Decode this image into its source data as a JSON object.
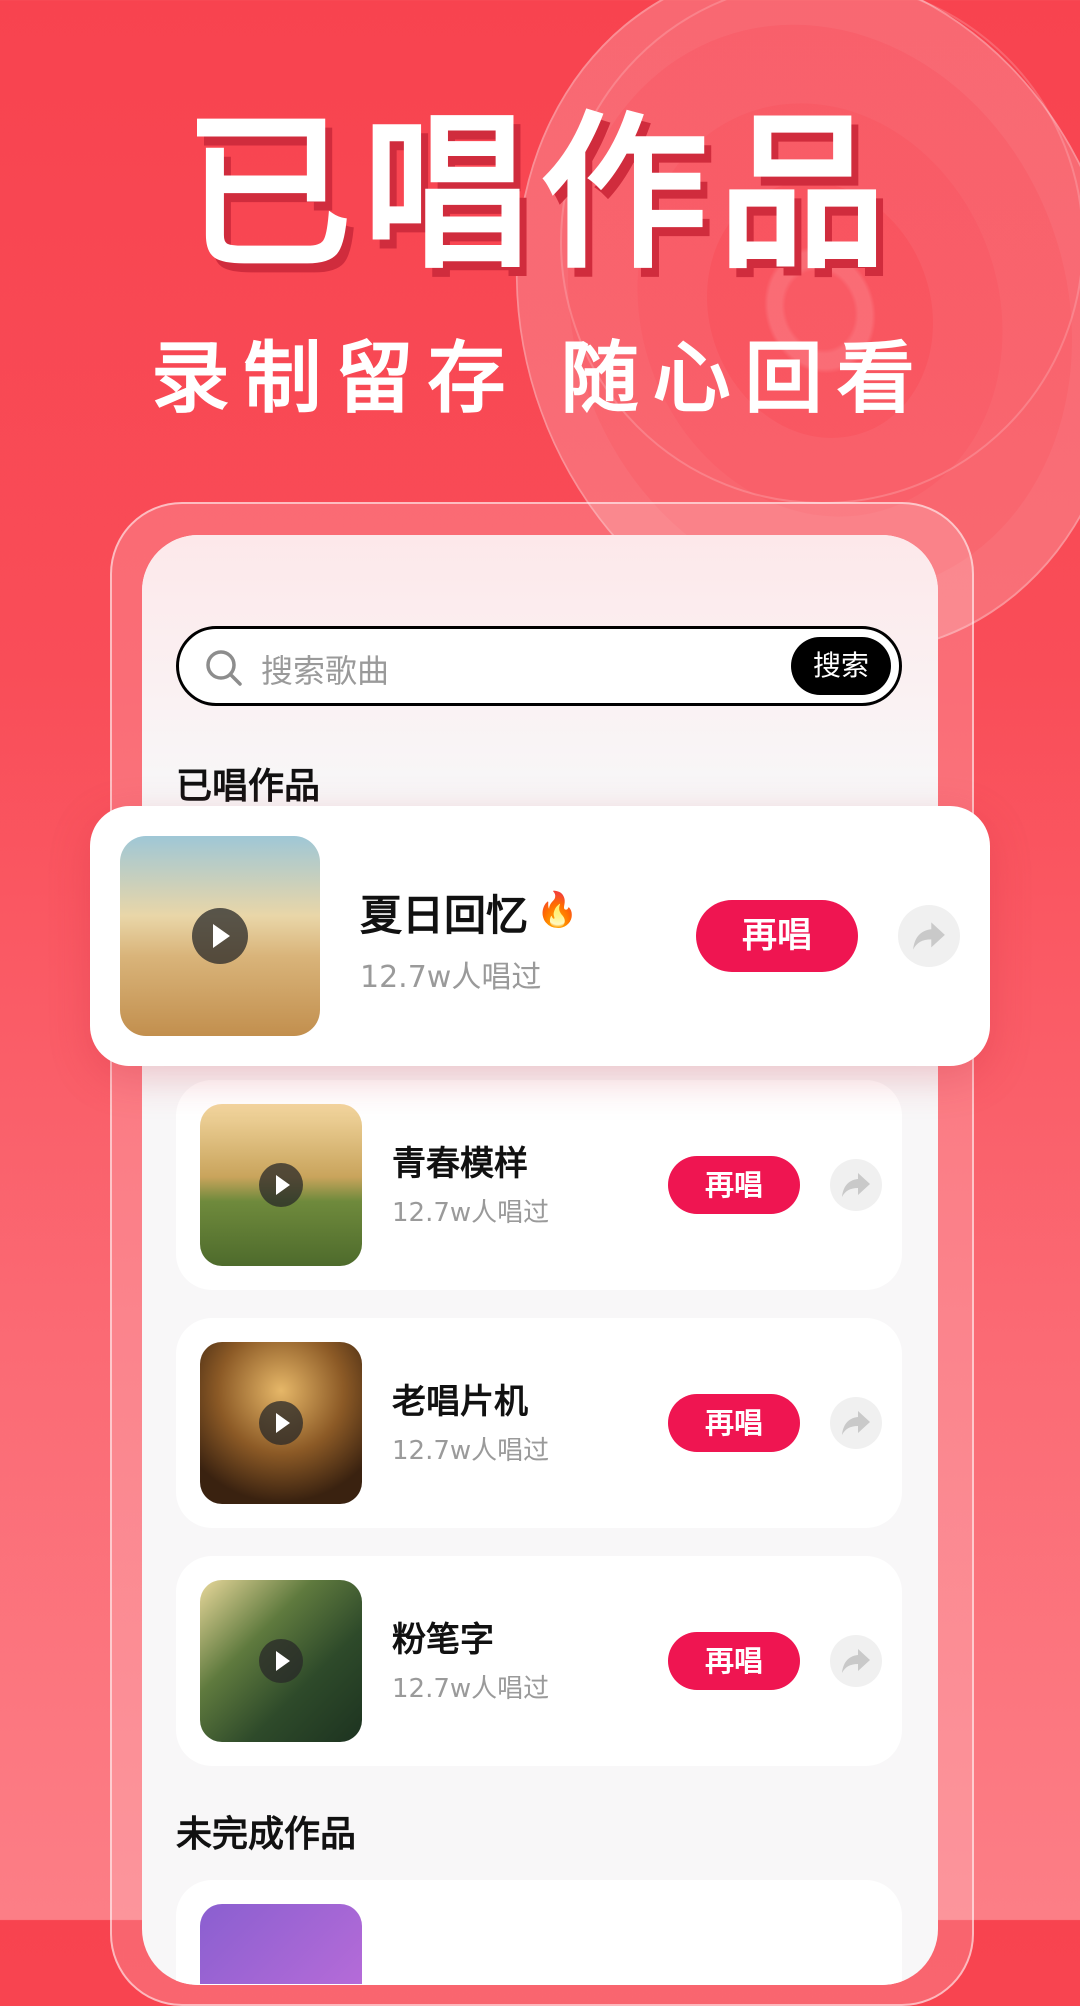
{
  "hero": {
    "title": "已唱作品",
    "subtitle": "录制留存 随心回看"
  },
  "search": {
    "placeholder": "搜索歌曲",
    "button_label": "搜索"
  },
  "sections": {
    "sung_title": "已唱作品",
    "unfinished_title": "未完成作品"
  },
  "featured_song": {
    "name": "夏日回忆",
    "badge_icon": "fire-icon",
    "badge_glyph": "🔥",
    "count": "12.7w人唱过",
    "action_label": "再唱"
  },
  "songs": [
    {
      "name": "青春模样",
      "count": "12.7w人唱过",
      "action_label": "再唱"
    },
    {
      "name": "老唱片机",
      "count": "12.7w人唱过",
      "action_label": "再唱"
    },
    {
      "name": "粉笔字",
      "count": "12.7w人唱过",
      "action_label": "再唱"
    }
  ],
  "colors": {
    "background_top": "#f8434f",
    "background_bottom": "#fc7e86",
    "accent": "#ef1551",
    "search_button": "#000000"
  }
}
